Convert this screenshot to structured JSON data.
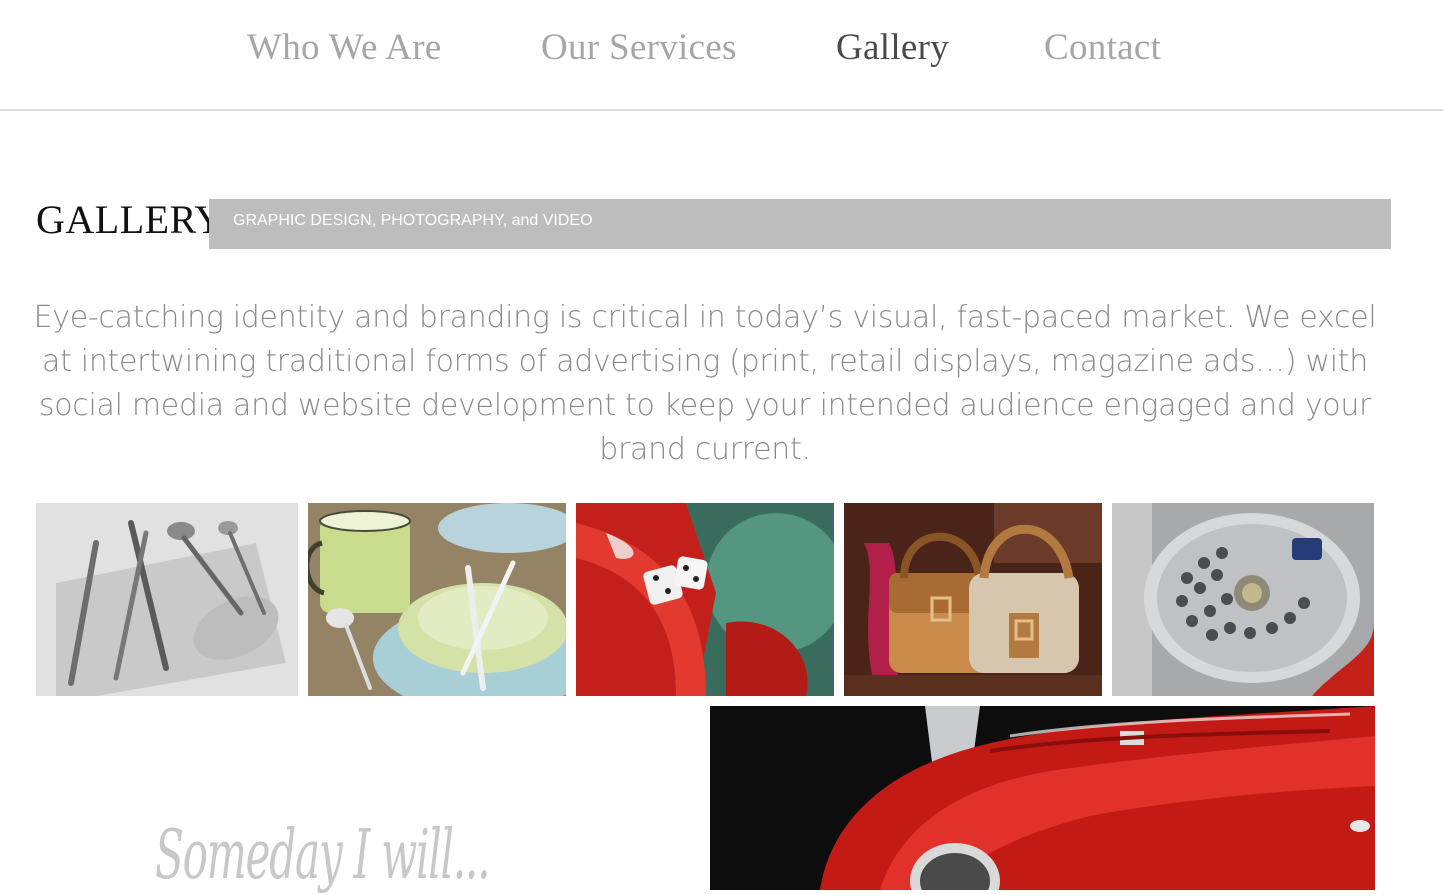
{
  "nav": {
    "items": [
      {
        "label": "Who We Are",
        "active": false
      },
      {
        "label": "Our Services",
        "active": false
      },
      {
        "label": "Gallery",
        "active": true
      },
      {
        "label": "Contact",
        "active": false
      }
    ]
  },
  "gallery": {
    "title": "GALLERY",
    "subtitle": "GRAPHIC DESIGN, PHOTOGRAPHY, and VIDEO",
    "intro": "Eye-catching identity and branding is critical in today’s visual, fast-paced market. We excel at intertwining traditional forms of advertising (print, retail displays, magazine ads…) with social media and website development to keep your intended audience engaged and your brand current.",
    "thumbnails": [
      {
        "subject": "silverware photo"
      },
      {
        "subject": "dinnerware photo"
      },
      {
        "subject": "red car with dice photo"
      },
      {
        "subject": "handbags photo"
      },
      {
        "subject": "chrome fan photo"
      }
    ],
    "handwriting": "Someday I will..."
  },
  "colors": {
    "nav_inactive": "#a6a6a6",
    "nav_active": "#4a4a4a",
    "bar": "#bdbdbd",
    "body_text": "#8a8a8a"
  }
}
